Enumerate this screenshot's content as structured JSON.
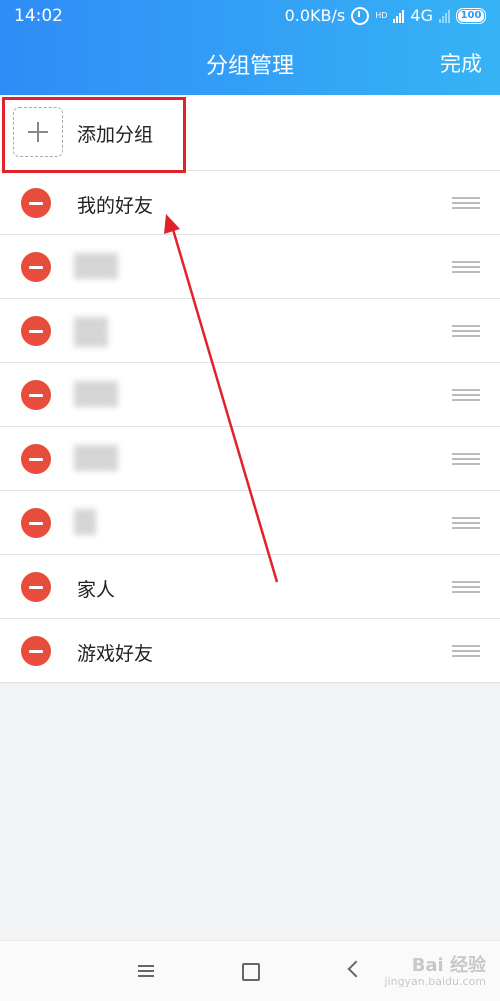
{
  "status_bar": {
    "time": "14:02",
    "speed": "0.0KB/s",
    "network": "4G",
    "hd_label": "HD",
    "battery": "100"
  },
  "header": {
    "title": "分组管理",
    "done_label": "完成"
  },
  "add_group": {
    "label": "添加分组"
  },
  "groups": [
    {
      "label": "我的好友"
    },
    {
      "label": ""
    },
    {
      "label": ""
    },
    {
      "label": ""
    },
    {
      "label": ""
    },
    {
      "label": ""
    },
    {
      "label": "家人"
    },
    {
      "label": "游戏好友"
    }
  ],
  "watermark": {
    "text": "Bai 经验",
    "sub": "jingyan.baidu.com"
  },
  "colors": {
    "header_start": "#2f8cf6",
    "header_end": "#36b3f5",
    "delete": "#e84c3d",
    "highlight": "#e3212b"
  }
}
